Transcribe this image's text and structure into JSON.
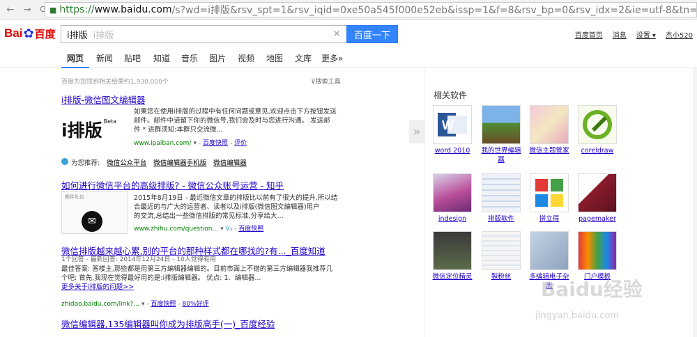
{
  "browser": {
    "url_scheme": "https://",
    "url_host": "www.baidu.com",
    "url_rest": "/s?wd=i排版&rsv_spt=1&rsv_iqid=0xe50a545f000e52eb&issp=1&f=8&rsv_bp=0&rsv_idx=2&ie=utf-8&tn=baiduhome_pg&rsv_ente"
  },
  "header": {
    "logo_bai": "Bai",
    "logo_du": "百度",
    "search_value": "i排版",
    "search_hint": "i排版",
    "search_button": "百度一下",
    "links": [
      "百度首页",
      "消息",
      "设置 ▾",
      "杰小520"
    ]
  },
  "tabs": [
    "网页",
    "新闻",
    "贴吧",
    "知道",
    "音乐",
    "图片",
    "视频",
    "地图",
    "文库",
    "更多»"
  ],
  "stats": "百度为您找到相关结果约1,930,000个",
  "tools": "搜索工具",
  "results": [
    {
      "title": "i排版-微信图文编辑器",
      "snippet_1": "如果您在使用i排版的过程中有任何问题或意见,欢迎点击下方按钮发送",
      "snippet_2": "邮件。邮件中请留下你的微信号,我们会及时与您进行沟通。 发送邮",
      "snippet_3": "件 * 进群须知:本群只交流微...",
      "url": "www.ipaiban.com/",
      "cache": "百度快照",
      "extra": "评价",
      "logo_text": "i排版",
      "logo_sup": "Beta"
    },
    {
      "title": "如何进行微信平台的高级排版? - 微信公众账号运营 - 知乎",
      "snippet_1": "2015年8月19日 - 最近微信文章的排版比以前有了很大的提升,所以结",
      "snippet_2": "合最近的与广大的运营者、读者以及i排版(微信图文编辑器)用户",
      "snippet_3": "的交流,总结出一些微信排版的常见标准,分享给大...",
      "url": "www.zhihu.com/question...",
      "cache": "百度快照",
      "thumb_label": "邮件礼仪"
    },
    {
      "title": "微信排版越来越心累,别的平台的那种样式都在哪找的?有..._百度知道",
      "meta": "1个回答 - 最新回答: 2014年12月24日 - 10人觉得有用",
      "snippet_1": "最佳答案: 答楼主,那些都是用第三方编辑器编辑的。目前市面上不错的第三方编辑器我推荐几",
      "snippet_2": "个吧: 首先,我现在觉得最好用的是:i排版编辑器。 优点: 1、编辑器...",
      "more": "更多关于i排版的问题>>",
      "url": "zhidao.baidu.com/link?...",
      "cache": "百度快照",
      "extra": "80%好评"
    },
    {
      "title": "微信编辑器,135编辑器叫你成为排版高手(一)_百度经验"
    }
  ],
  "recommend": {
    "label": "为您推荐:",
    "items": [
      "微信公众平台",
      "微信编辑器手机版",
      "微信编辑器"
    ]
  },
  "related": {
    "title": "相关软件",
    "items": [
      {
        "name": "word 2010",
        "icon": "word-icon"
      },
      {
        "name": "我的世界编辑器",
        "icon": "minecraft-icon"
      },
      {
        "name": "微信主题管家",
        "icon": "theme-icon"
      },
      {
        "name": "coreldraw",
        "icon": "coreldraw-icon"
      },
      {
        "name": "indesign",
        "icon": "indesign-icon"
      },
      {
        "name": "排版软件",
        "icon": "typeset-icon"
      },
      {
        "name": "拼立得",
        "icon": "pinlide-icon"
      },
      {
        "name": "pagemaker",
        "icon": "pagemaker-icon"
      },
      {
        "name": "微信定位精灵",
        "icon": "location-icon"
      },
      {
        "name": "製粉丝",
        "icon": "fans-icon"
      },
      {
        "name": "多编辑电子杂志",
        "icon": "magazine-icon"
      },
      {
        "name": "门户模板",
        "icon": "portal-icon"
      }
    ]
  },
  "watermark": {
    "main": "Baidu经验",
    "sub": "jingyan.baidu.com"
  }
}
